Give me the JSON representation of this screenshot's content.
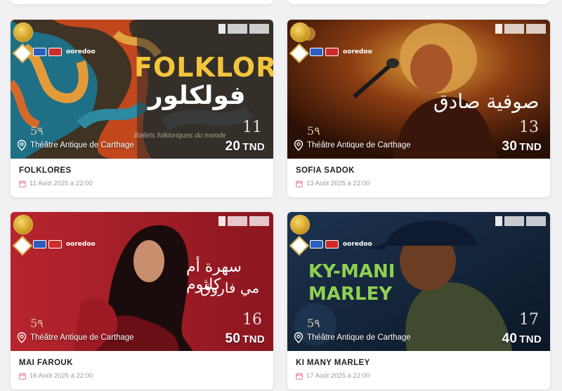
{
  "cards": [
    {
      "title": "FOLKLORES",
      "date": "11 Août 2025 à 22:00",
      "venue": "Théâtre Antique de Carthage",
      "price": "20",
      "currency": "TND",
      "day": "11",
      "poster_title": "FOLKLORES",
      "poster_arabic": "فولكلور",
      "poster_sub": "Ballets folkloriques du monde",
      "sponsor": "ooredoo"
    },
    {
      "title": "SOFIA SADOK",
      "date": "13 Août 2025 à 22:00",
      "venue": "Théâtre Antique de Carthage",
      "price": "30",
      "currency": "TND",
      "day": "13",
      "poster_arabic": "صوفية صادق",
      "sponsor": "ooredoo"
    },
    {
      "title": "MAI FAROUK",
      "date": "16 Août 2025 à 22:00",
      "venue": "Théâtre Antique de Carthage",
      "price": "50",
      "currency": "TND",
      "day": "16",
      "poster_arabic": "سهرة أم كلثوم",
      "poster_arabic2": "مي فاروق",
      "sponsor": "ooredoo"
    },
    {
      "title": "KI MANY MARLEY",
      "date": "17 Août 2025 à 22:00",
      "venue": "Théâtre Antique de Carthage",
      "price": "40",
      "currency": "TND",
      "day": "17",
      "poster_title": "KY-MANI",
      "poster_title2": "MARLEY",
      "sponsor": "ooredoo"
    }
  ],
  "icons": {
    "venue": "map-pin-icon",
    "date": "calendar-icon"
  },
  "colors": {
    "calendar": "#e8749a",
    "text_title": "#222222",
    "text_date": "#9a9a9a"
  }
}
